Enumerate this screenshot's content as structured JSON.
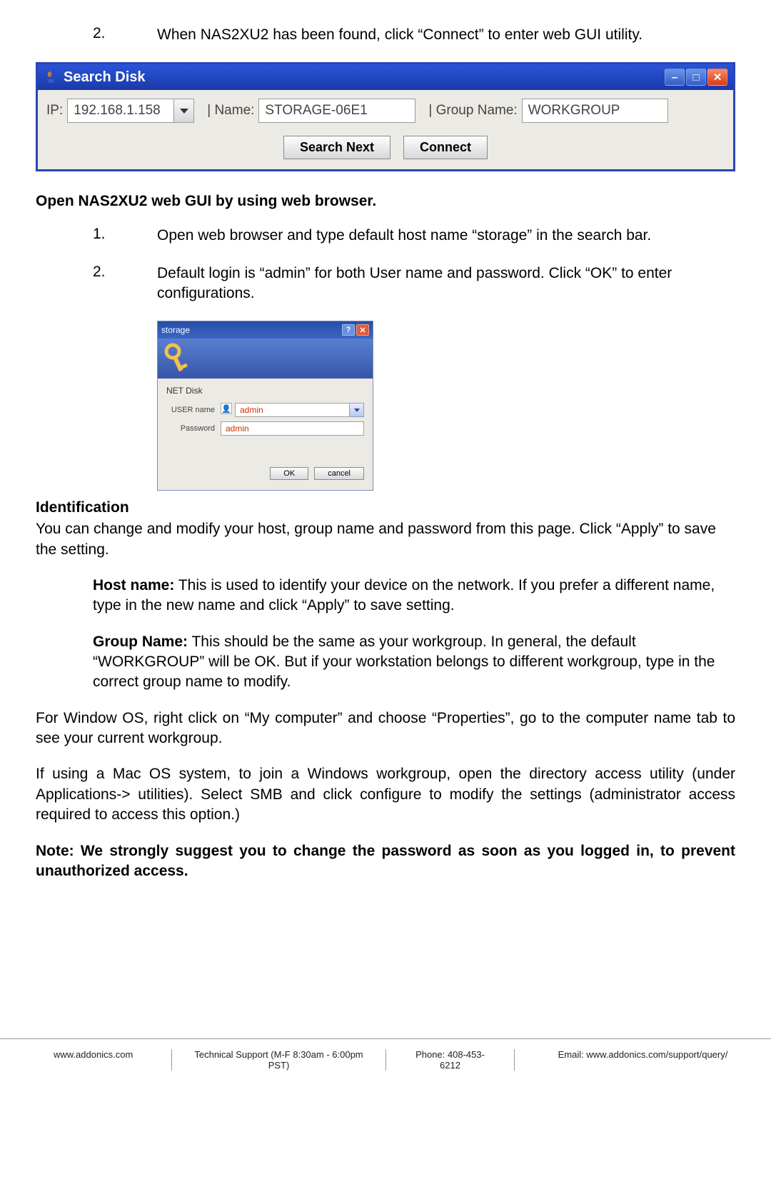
{
  "step_top": {
    "num": "2.",
    "text": "When NAS2XU2 has been found, click “Connect” to enter web GUI utility."
  },
  "search_win": {
    "title": "Search Disk",
    "ip_label": "IP:",
    "ip_value": "192.168.1.158",
    "name_label": "| Name:",
    "name_value": "STORAGE-06E1",
    "group_label": "| Group Name:",
    "group_value": "WORKGROUP",
    "btn_next": "Search Next",
    "btn_connect": "Connect"
  },
  "open_heading": "Open NAS2XU2 web GUI by using web browser.",
  "open_steps": [
    {
      "num": "1.",
      "text": "Open web browser and type default host name “storage” in the search bar."
    },
    {
      "num": "2.",
      "text": "Default login is “admin” for both User name and password. Click “OK” to enter configurations."
    }
  ],
  "login": {
    "title": "storage",
    "section": "NET Disk",
    "user_label": "USER name",
    "user_value": "admin",
    "pass_label": "Password",
    "pass_value": "admin",
    "btn_ok": "OK",
    "btn_cancel": "cancel"
  },
  "ident": {
    "heading": "Identification",
    "intro": "You can change and modify your host, group name and password from this page. Click “Apply” to save the setting.",
    "host_label": "Host name:",
    "host_text": " This is used to identify your device on the network. If you prefer a different name, type in the new name and click “Apply” to save setting.",
    "group_label": "Group Name:",
    "group_text": " This should be the same as your workgroup. In general, the default “WORKGROUP” will be OK. But if your workstation belongs to different workgroup, type in the correct group name to modify.",
    "windows_text": "For Window OS, right click on “My computer” and choose “Properties”, go to the computer name tab to see your current workgroup.",
    "mac_text": "If using a Mac OS system, to join a Windows workgroup, open the directory access utility (under Applications-> utilities). Select SMB and click configure to modify the settings (administrator access required to access this option.)",
    "note": "Note: We strongly suggest you to change the password as soon as you logged in, to prevent unauthorized access."
  },
  "footer": {
    "site": "www.addonics.com",
    "support": "Technical Support (M-F 8:30am - 6:00pm PST)",
    "phone": "Phone: 408-453-6212",
    "email": "Email: www.addonics.com/support/query/"
  }
}
